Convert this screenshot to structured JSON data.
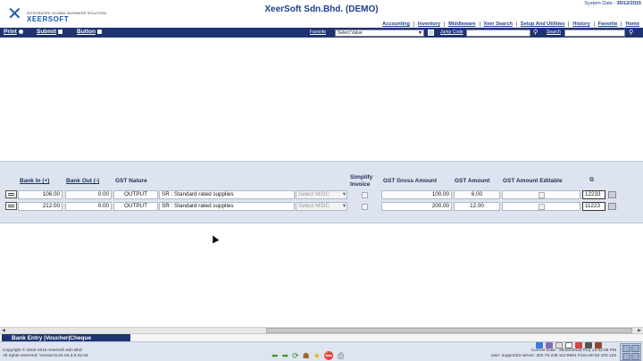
{
  "header": {
    "company": "XeerSoft Sdn.Bhd. (DEMO)",
    "system_date_label": "System Date :",
    "system_date": "30/12/2015",
    "logo_tagline": "INTEGRATED GLOBAL BUSINESS SOLUTION",
    "logo_name": "XEERSOFT",
    "menu": [
      "Accounting",
      "Inventory",
      "Middleware",
      "Xeer Search",
      "Setup And Utilities",
      "History",
      "Favorite",
      "Home"
    ]
  },
  "toolbar": {
    "print": "Print",
    "submit": "Submit",
    "button": "Button",
    "favorite_label": "Favorite",
    "favorite_value": "Select Value",
    "jump_label": "Jump Code",
    "search_label": "Search"
  },
  "grid": {
    "headers": {
      "bank_in": "Bank In (+)",
      "bank_out": "Bank Out (-)",
      "gst_nature": "GST Nature",
      "simplify_1": "Simplify",
      "simplify_2": "Invoice",
      "gst_gross": "GST Gross Amount",
      "gst_amount": "GST Amount",
      "gst_editable": "GST Amount Editable"
    },
    "rows": [
      {
        "bank_in": "106.00",
        "bank_out": "0.00",
        "nature": "OUTPUT",
        "tax_code": "SR : Standard rated supplies",
        "msic": "Select MSIC",
        "gross": "100.00",
        "gst": "6.00",
        "code": "12233"
      },
      {
        "bank_in": "212.00",
        "bank_out": "0.00",
        "nature": "OUTPUT",
        "tax_code": "SR : Standard rated supplies",
        "msic": "Select MSIC",
        "gross": "200.00",
        "gst": "12.00",
        "code": "11223"
      }
    ]
  },
  "tabs": {
    "active": "Bank Entry |Voucher|Cheque"
  },
  "footer": {
    "copyright_1": "Copyright © 2002-2015 Xeersoft Sdn Bhd",
    "copyright_2": "All rights reserved. Version:5.02.04.d.5.02.04",
    "info_1": "Current Date : 29/10/2015(Thu) 12:02:05 PM",
    "info_2": "user: support33 server: 202.76.236.112:9991 From:60.52.103.120"
  },
  "colors": {
    "navy": "#1e3470",
    "panel": "#dde4ef",
    "brand_blue": "#1a5aa8"
  }
}
